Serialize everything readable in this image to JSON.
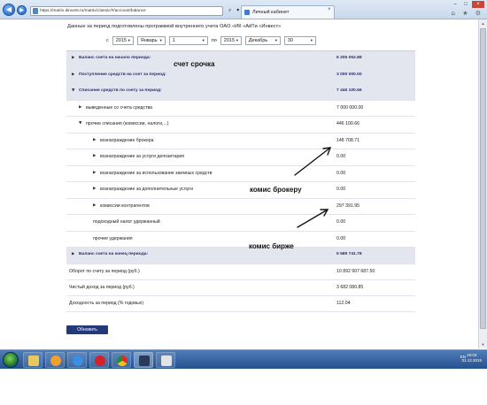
{
  "browser": {
    "address": "https://matrix.itinvest.ru/matrix/classic/#/account/balance",
    "tab_title": "Личный кабинет",
    "tools_glyphs": "⌕ ▾ ↻",
    "tab_close": "×",
    "window_controls": [
      "–",
      "□",
      "×"
    ],
    "right_icons": "⌂ ★ ⚙",
    "back": "◀",
    "forward": "▶"
  },
  "page": {
    "header": "Данные за период подготовлены программой внутреннего учета ОАО «ИК «АйТи «Инвест»",
    "period": {
      "from_label": "с",
      "to_label": "по",
      "from_year": "2015",
      "from_month": "Январь",
      "from_day": "1",
      "to_year": "2015",
      "to_month": "Декабрь",
      "to_day": "30"
    },
    "rows": [
      {
        "label": "Баланс счета на начало периода:",
        "value": "6 205 052.88"
      },
      {
        "label": "Поступление средств на счет за период:",
        "value": "3 000 000.00"
      },
      {
        "label": "Списание средств по счету за период:",
        "value": "7 446 100.66"
      },
      {
        "label": "выведенные со счета средства",
        "value": "7 000 000.00"
      },
      {
        "label": "прочие списания (комиссии, налоги,...)",
        "value": "446 100.66"
      },
      {
        "label": "вознаграждение брокера",
        "value": "148 708.71"
      },
      {
        "label": "вознаграждение за услуги депозитария",
        "value": "0.00"
      },
      {
        "label": "вознаграждение за использование заемных средств",
        "value": "0.00"
      },
      {
        "label": "вознаграждение за дополнительные услуги",
        "value": "0.00"
      },
      {
        "label": "комиссии контрагентов",
        "value": "297 391.95"
      },
      {
        "label": "подоходный налог удержанный",
        "value": "0.00"
      },
      {
        "label": "прочие удержания",
        "value": "0.00"
      },
      {
        "label": "Баланс счета на конец периода:",
        "value": "5 589 741.78"
      }
    ],
    "summary": [
      {
        "label": "Оборот по счету за период (руб.)",
        "value": "10 892 907 687.50"
      },
      {
        "label": "Чистый доход за период (руб.)",
        "value": "3 682 080.85"
      },
      {
        "label": "Доходность за период (% годовых)",
        "value": "112.04"
      }
    ],
    "refresh_button": "Обновить"
  },
  "annotations": {
    "account_note": "счет срочка",
    "broker_note": "комис брокеру",
    "exchange_note": "комис бирже"
  },
  "taskbar": {
    "lang": "EN",
    "time": "19:03",
    "date": "31.12.2015",
    "icons": [
      "explorer-icon",
      "media-player-icon",
      "ie-icon",
      "opera-icon",
      "chrome-icon",
      "trading-terminal-icon",
      "paint-icon"
    ]
  },
  "colors": {
    "section_bg": "#e4e6ef",
    "section_text": "#2b2f6a",
    "button_bg": "#223a7a",
    "taskbar": "#25518f"
  }
}
